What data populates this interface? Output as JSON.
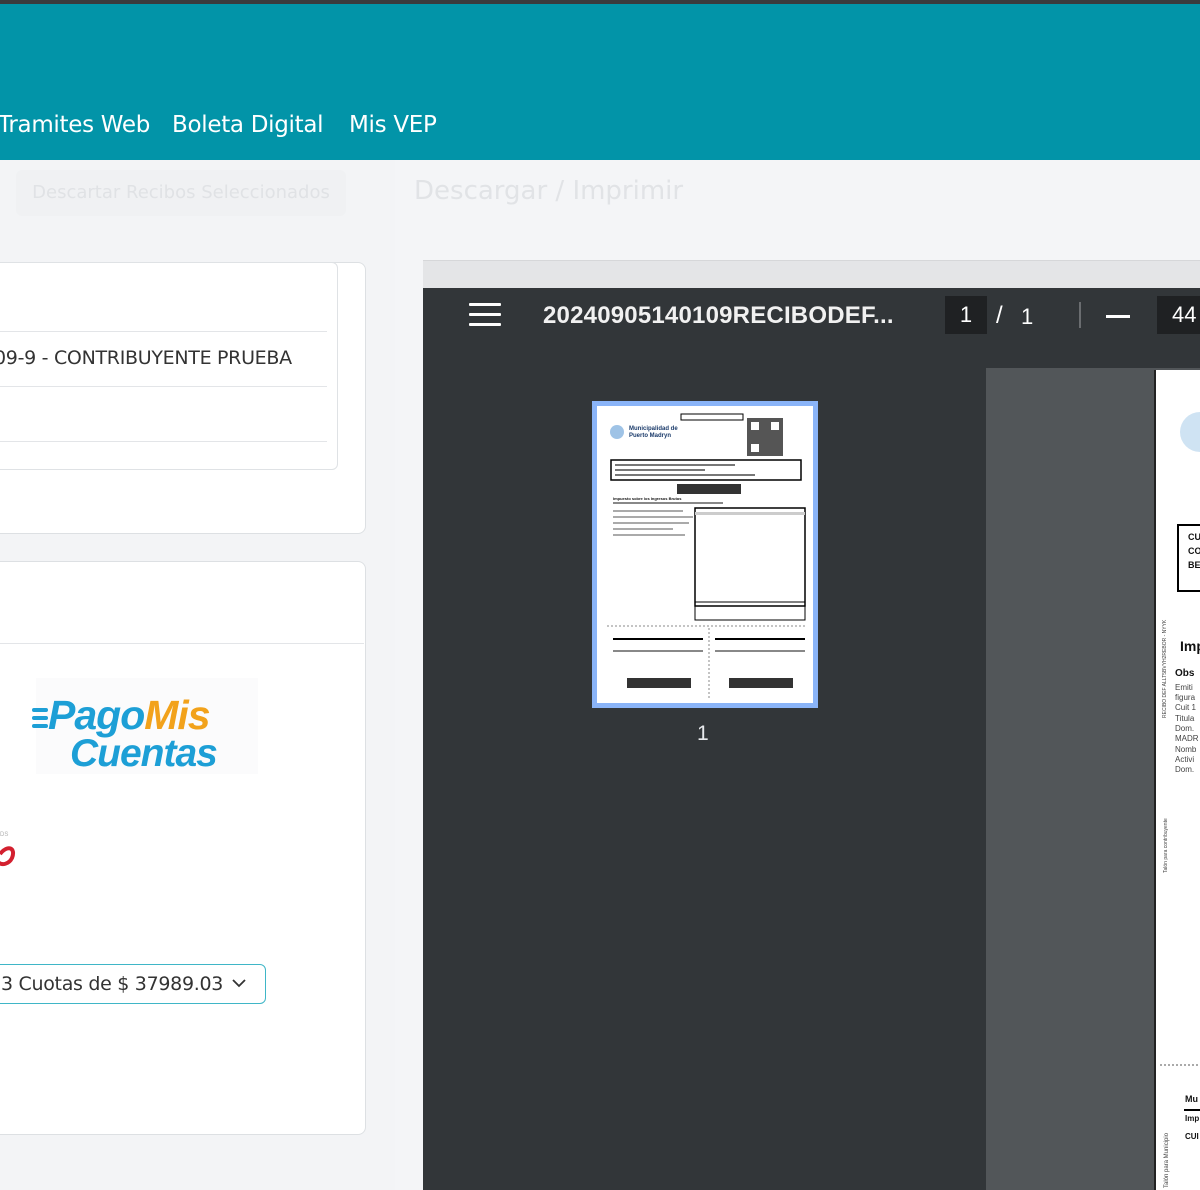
{
  "nav": {
    "items": [
      {
        "label": "Tramites Web"
      },
      {
        "label": "Boleta Digital"
      },
      {
        "label": "Mis VEP"
      }
    ]
  },
  "actions": {
    "discard_label": "Descartar Recibos Seleccionados",
    "print_heading": "Descargar / Imprimir"
  },
  "receipt_table": {
    "row_text": "09-9 - CONTRIBUYENTE PRUEBA"
  },
  "payment": {
    "logo_pago": "Pago",
    "logo_mis": "Mis",
    "logo_cuentas": "Cuentas",
    "red_logo_text": "DS",
    "cuotas_selected": "3 Cuotas de $ 37989.03"
  },
  "pdf_viewer": {
    "file_name": "20240905140109RECIBODEF...",
    "current_page": "1",
    "page_separator": "/",
    "total_pages": "1",
    "zoom": "44",
    "thumbnail_label": "1",
    "thumb_header": "Municipalidad de Puerto Madryn",
    "thumb_title": "Impuesto sobre los Ingresos Brutos",
    "page_text": {
      "box_lines": [
        "CU",
        "CO",
        "BE"
      ],
      "heading": "Imp",
      "obs": "Obs",
      "lines": [
        "Emiti",
        "figura",
        "Cuit 1",
        "Titula",
        "Dom.",
        "MADR",
        "Nomb",
        "Activi",
        "Dom."
      ],
      "footer_1": "Mu",
      "footer_2": "Imp",
      "footer_3": "CUI",
      "side_1": "RECIBO DEF ALLT5BVYH2REBOR - NYYK",
      "side_2": "Talón para contribuyente",
      "side_3": "Talón para Municipio"
    }
  },
  "colors": {
    "navbar": "#0294a8",
    "accent": "#3fb6c7",
    "viewer_bg": "#323639",
    "thumb_selected": "#8ab4f8"
  }
}
